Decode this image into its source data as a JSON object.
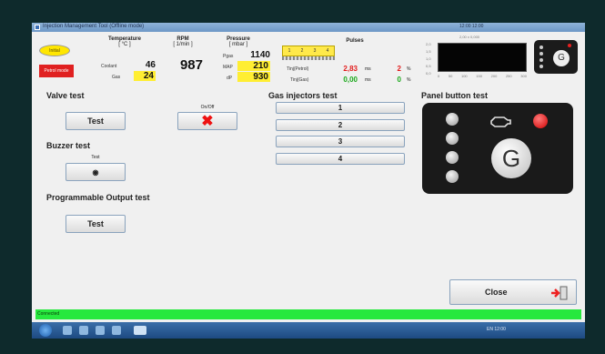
{
  "window": {
    "title": "Injection Management Tool (Offline mode)",
    "right_text": "12:00 12:00"
  },
  "status": {
    "pill": "Initial",
    "red_box": "Petrol mode"
  },
  "temperature": {
    "header": "Temperature",
    "unit": "[ °C ]",
    "coolant_label": "Coolant",
    "coolant_value": "46",
    "gas_label": "Gas",
    "gas_value": "24"
  },
  "rpm": {
    "header": "RPM",
    "unit": "[ 1/min ]",
    "value": "987"
  },
  "pressure": {
    "header": "Pressure",
    "unit": "[ mbar ]",
    "rows": [
      {
        "label": "Pgas",
        "value": "1140"
      },
      {
        "label": "MAP",
        "value": "210"
      },
      {
        "label": "dP",
        "value": "930"
      }
    ]
  },
  "pulses": {
    "header": "Pulses",
    "cells": [
      "1",
      "2",
      "3",
      "4"
    ],
    "petrol_label": "Tinj(Petrol)",
    "petrol_value": "2,83",
    "petrol_unit": "ms",
    "gas_label": "Tinj(Gas)",
    "gas_value": "0,00",
    "gas_unit": "ms",
    "pct1": "2",
    "pct2": "0",
    "pct_unit": "%"
  },
  "scope": {
    "title": "2,00 x 0,000",
    "y_ticks": [
      "2,0",
      "1,5",
      "1,0",
      "0,5",
      "0,0"
    ],
    "x_ticks": [
      "0",
      "50",
      "100",
      "150",
      "200",
      "250",
      "300"
    ]
  },
  "valve": {
    "title": "Valve test",
    "test_label": "Test",
    "onoff_label": "On/Off"
  },
  "buzzer": {
    "title": "Buzzer test",
    "test_caption": "Test"
  },
  "prog_output": {
    "title": "Programmable Output test",
    "test_label": "Test"
  },
  "injectors": {
    "title": "Gas injectors test",
    "buttons": [
      "1",
      "2",
      "3",
      "4"
    ]
  },
  "panel_test": {
    "title": "Panel button test",
    "g_label": "G"
  },
  "close": {
    "label": "Close"
  },
  "statusbar": {
    "text": "Connected"
  },
  "taskbar": {
    "tray": "EN  12:00"
  },
  "colors": {
    "accent_green": "#27e83e",
    "led_red": "#d00000",
    "highlight_yellow": "#ffee33"
  }
}
